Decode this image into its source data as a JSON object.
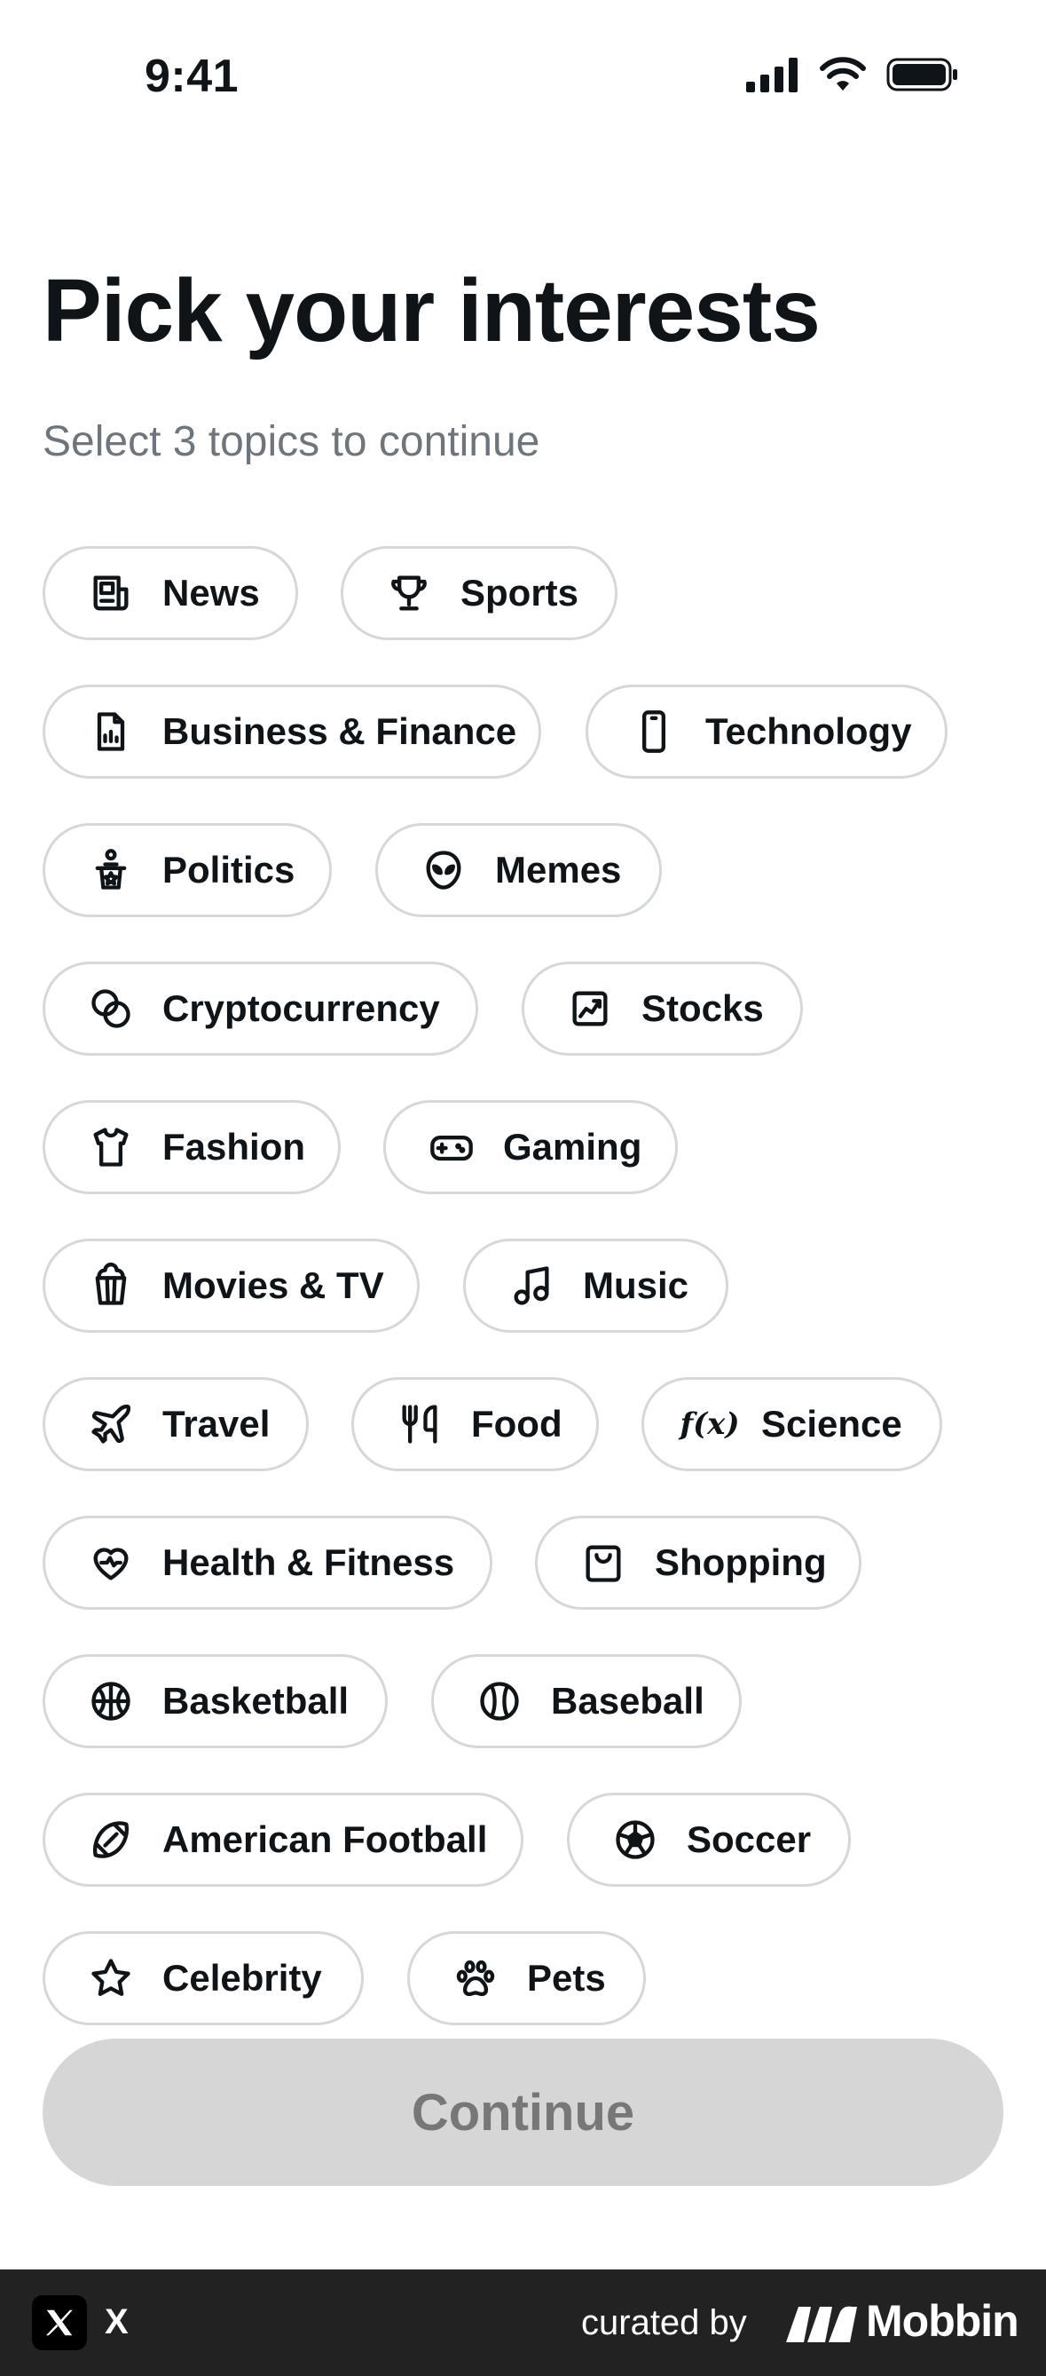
{
  "status_bar": {
    "time": "9:41",
    "icons": [
      "cellular-signal-icon",
      "wifi-icon",
      "battery-icon"
    ]
  },
  "header": {
    "title": "Pick your interests",
    "subtitle": "Select 3 topics to continue"
  },
  "topics": [
    {
      "label": "News",
      "icon": "newspaper-icon"
    },
    {
      "label": "Sports",
      "icon": "trophy-icon"
    },
    {
      "label": "Business & Finance",
      "icon": "document-chart-icon"
    },
    {
      "label": "Technology",
      "icon": "phone-icon"
    },
    {
      "label": "Politics",
      "icon": "podium-icon"
    },
    {
      "label": "Memes",
      "icon": "alien-face-icon"
    },
    {
      "label": "Cryptocurrency",
      "icon": "coins-icon"
    },
    {
      "label": "Stocks",
      "icon": "stock-chart-icon"
    },
    {
      "label": "Fashion",
      "icon": "tshirt-icon"
    },
    {
      "label": "Gaming",
      "icon": "gamepad-icon"
    },
    {
      "label": "Movies & TV",
      "icon": "popcorn-icon"
    },
    {
      "label": "Music",
      "icon": "music-note-icon"
    },
    {
      "label": "Travel",
      "icon": "airplane-icon"
    },
    {
      "label": "Food",
      "icon": "fork-knife-icon"
    },
    {
      "label": "Science",
      "icon": "function-icon",
      "icon_text": "f(x)"
    },
    {
      "label": "Health & Fitness",
      "icon": "heart-pulse-icon"
    },
    {
      "label": "Shopping",
      "icon": "shopping-bag-icon"
    },
    {
      "label": "Basketball",
      "icon": "basketball-icon"
    },
    {
      "label": "Baseball",
      "icon": "baseball-icon"
    },
    {
      "label": "American Football",
      "icon": "football-icon"
    },
    {
      "label": "Soccer",
      "icon": "soccer-ball-icon"
    },
    {
      "label": "Celebrity",
      "icon": "star-icon"
    },
    {
      "label": "Pets",
      "icon": "paw-icon"
    }
  ],
  "continue_button": {
    "label": "Continue",
    "enabled": false
  },
  "footer": {
    "app_name": "X",
    "curated_by": "curated by",
    "brand": "Mobbin"
  },
  "colors": {
    "text": "#0f1419",
    "subtitle": "#6e767d",
    "chip_border": "#d4d8db",
    "button_disabled_bg": "#d6d6d6",
    "button_disabled_text": "#777777",
    "footer_bg": "#222222"
  }
}
